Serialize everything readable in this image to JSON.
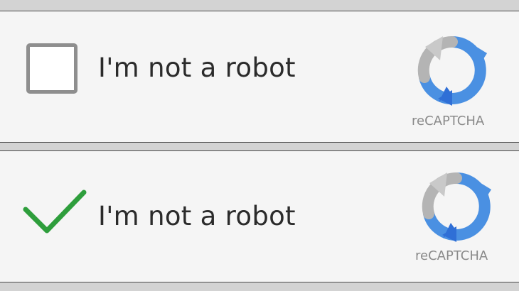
{
  "widgets": [
    {
      "state": "unchecked",
      "label": "I'm not a robot",
      "brand": "reCAPTCHA"
    },
    {
      "state": "checked",
      "label": "I'm not a robot",
      "brand": "reCAPTCHA"
    }
  ],
  "colors": {
    "checkbox_border": "#8e8e8e",
    "checkmark": "#2e9e3c",
    "logo_blue_light": "#4a90e2",
    "logo_blue_dark": "#2f6fd6",
    "logo_gray": "#b4b4b4"
  },
  "icons": {
    "logo": "recaptcha-logo-icon",
    "check": "checkmark-icon"
  }
}
